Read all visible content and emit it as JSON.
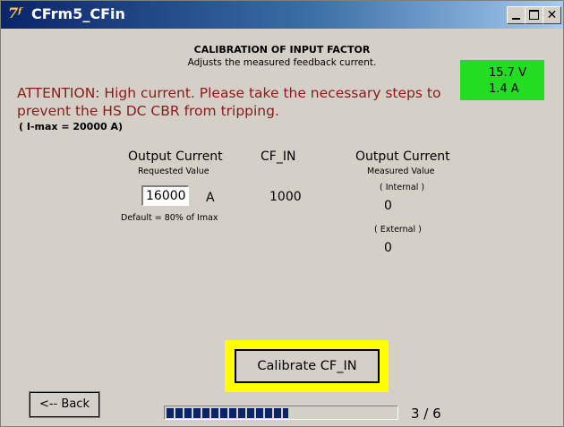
{
  "window": {
    "icon": "app-logo-icon",
    "icon_glyph": "7ᶠ",
    "title": "CFrm5_CFin",
    "close_glyph": "✕"
  },
  "header": {
    "title": "CALIBRATION OF INPUT FACTOR",
    "subtitle": "Adjusts the measured feedback current."
  },
  "readout": {
    "voltage": "15.7 V",
    "current": "1.4 A",
    "background": "#22dd22"
  },
  "attention": {
    "text": "ATTENTION: High current. Please take the necessary steps to prevent the HS DC CBR from tripping.",
    "color": "#8b1a1a"
  },
  "imax": "( I-max = 20000 A)",
  "requested": {
    "header": "Output Current",
    "sublabel": "Requested Value",
    "value": "16000",
    "unit": "A",
    "default_note": "Default = 80% of Imax"
  },
  "cf_in": {
    "header": "CF_IN",
    "value": "1000"
  },
  "measured": {
    "header": "Output Current",
    "sublabel": "Measured Value",
    "internal_label": "( Internal )",
    "internal_value": "0",
    "external_label": "( External )",
    "external_value": "0"
  },
  "calibrate_button": "Calibrate CF_IN",
  "back_button": "<-- Back",
  "progress": {
    "fraction": 0.53,
    "step_label": "3 / 6",
    "fill_color": "#0a246a"
  }
}
